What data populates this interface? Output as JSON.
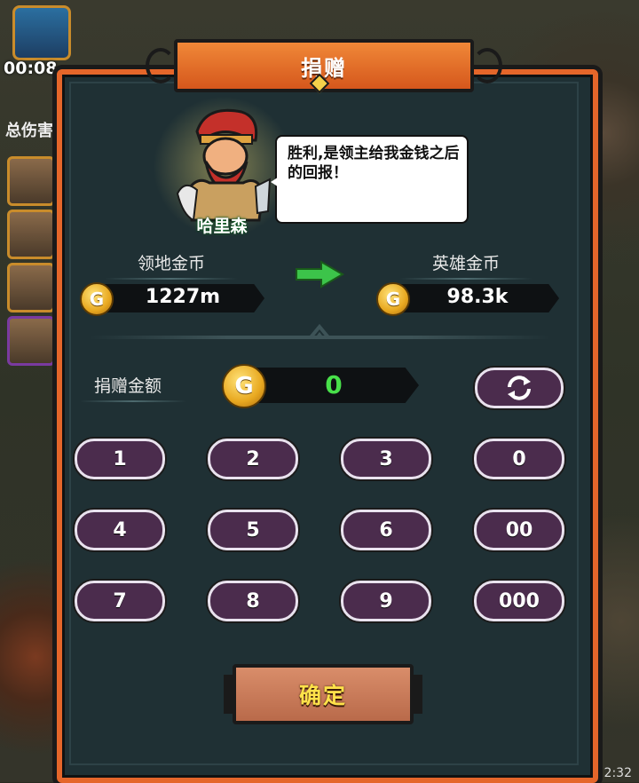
{
  "hud": {
    "timer": "00:08",
    "damage_label": "总伤害",
    "bottom_time": "2:32"
  },
  "dialog": {
    "title": "捐赠",
    "hero_name": "哈里森",
    "speech": "胜利,是领主给我金钱之后的回报！",
    "territory_gold_label": "领地金币",
    "territory_gold_value": "1227m",
    "hero_gold_label": "英雄金币",
    "hero_gold_value": "98.3k",
    "donate_label": "捐赠金额",
    "donate_value": "0",
    "coin_glyph": "G",
    "keypad": [
      "1",
      "2",
      "3",
      "0",
      "4",
      "5",
      "6",
      "00",
      "7",
      "8",
      "9",
      "000"
    ],
    "confirm_label": "确定"
  },
  "colors": {
    "panel_border": "#e5662a",
    "panel_bg": "#1f3034",
    "pill_bg": "#4b2c4d",
    "donate_value": "#48e04a",
    "confirm_text": "#ffe24a"
  },
  "icons": [
    "treasure-chest-icon",
    "gold-coin-icon",
    "green-arrow-icon",
    "refresh-icon"
  ]
}
